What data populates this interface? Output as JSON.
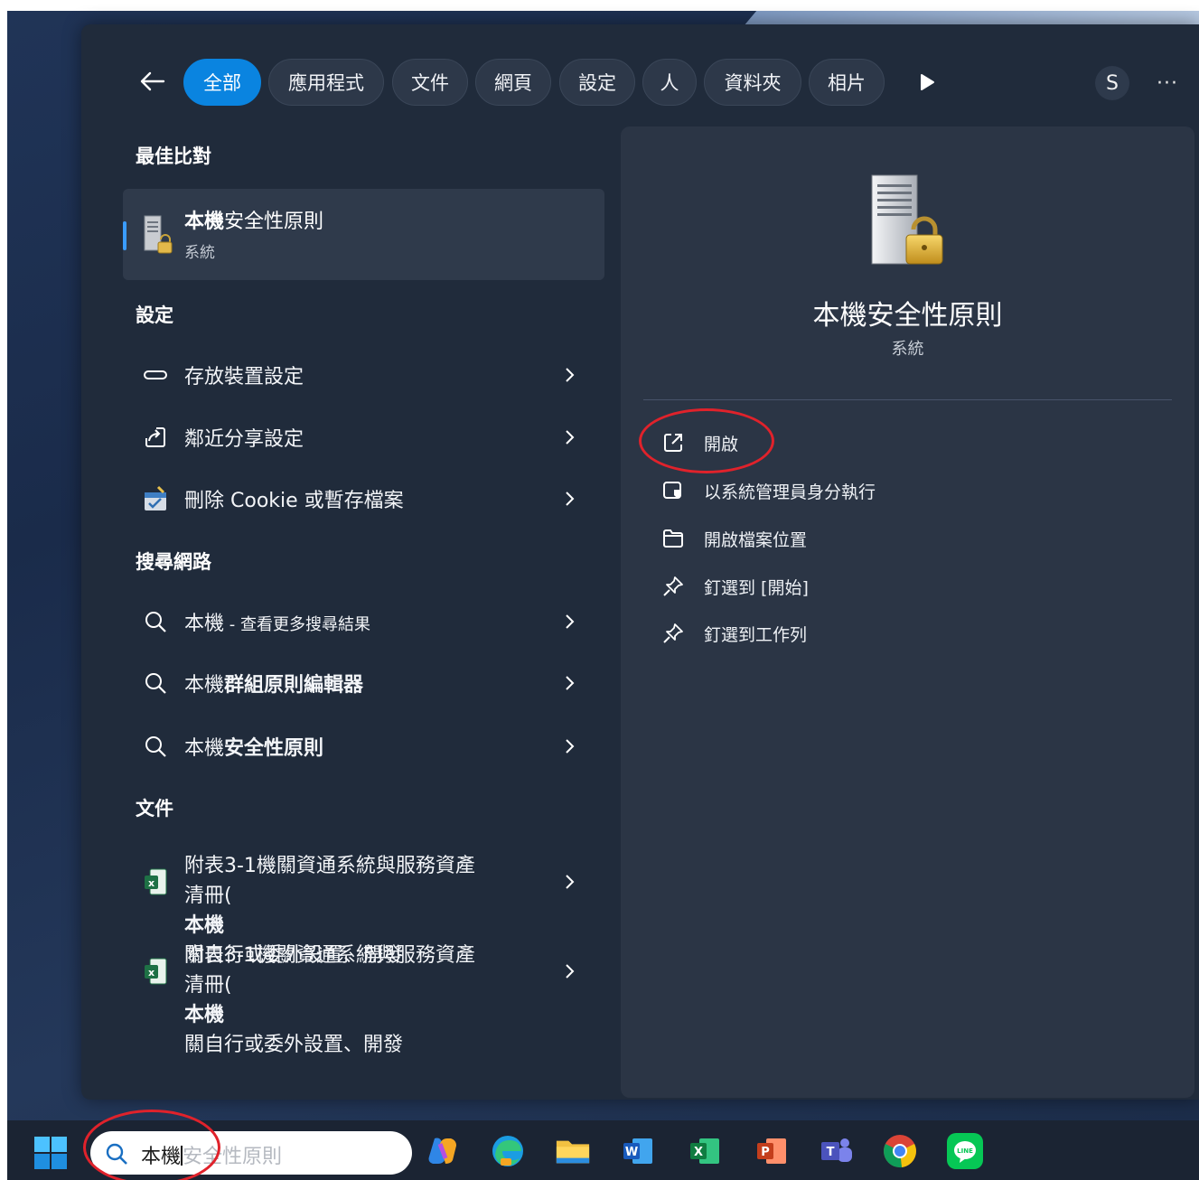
{
  "filter_bar": {
    "chips": [
      {
        "label": "全部",
        "active": true
      },
      {
        "label": "應用程式",
        "active": false
      },
      {
        "label": "文件",
        "active": false
      },
      {
        "label": "網頁",
        "active": false
      },
      {
        "label": "設定",
        "active": false
      },
      {
        "label": "人",
        "active": false
      },
      {
        "label": "資料夾",
        "active": false
      },
      {
        "label": "相片",
        "active": false
      }
    ],
    "avatar_initial": "S",
    "more_label": "···"
  },
  "best_match": {
    "heading": "最佳比對",
    "name_bold": "本機",
    "name_rest": "安全性原則",
    "type": "系統"
  },
  "settings": {
    "heading": "設定",
    "items": [
      {
        "label": "存放裝置設定",
        "icon": "storage-icon"
      },
      {
        "label": "鄰近分享設定",
        "icon": "share-icon"
      },
      {
        "label": "刪除 Cookie 或暫存檔案",
        "icon": "cleanup-icon"
      }
    ]
  },
  "web_search": {
    "heading": "搜尋網路",
    "items": [
      {
        "prefix": "本機",
        "suffix": " - 查看更多搜尋結果",
        "bold": false
      },
      {
        "prefix": "本機",
        "suffix": "群組原則編輯器",
        "bold": true
      },
      {
        "prefix": "本機",
        "suffix": "安全性原則",
        "bold": true
      }
    ]
  },
  "documents": {
    "heading": "文件",
    "items": [
      {
        "line1": "附表3-1機關資通系統與服務資產",
        "line2_pre": "清冊(",
        "line2_bold": "本機",
        "line2_post": "關自行或委外設置、開發"
      },
      {
        "line1": "附表3-1機關資通系統與服務資產",
        "line2_pre": "清冊(",
        "line2_bold": "本機",
        "line2_post": "關自行或委外設置、開發"
      }
    ]
  },
  "detail": {
    "title": "本機安全性原則",
    "subtitle": "系統",
    "actions": [
      {
        "label": "開啟",
        "icon": "open-external-icon"
      },
      {
        "label": "以系統管理員身分執行",
        "icon": "run-as-admin-icon"
      },
      {
        "label": "開啟檔案位置",
        "icon": "folder-icon"
      },
      {
        "label": "釘選到 [開始]",
        "icon": "pin-icon"
      },
      {
        "label": "釘選到工作列",
        "icon": "pin-icon"
      }
    ]
  },
  "taskbar": {
    "search_typed": "本機",
    "search_ghost": "安全性原則",
    "apps": [
      "copilot-icon",
      "edge-icon",
      "file-explorer-icon",
      "word-icon",
      "excel-icon",
      "powerpoint-icon",
      "teams-icon",
      "chrome-icon",
      "line-icon"
    ]
  },
  "colors": {
    "accent": "#0a84e0",
    "panel": "#202b3b",
    "annotation": "#e0222b"
  }
}
